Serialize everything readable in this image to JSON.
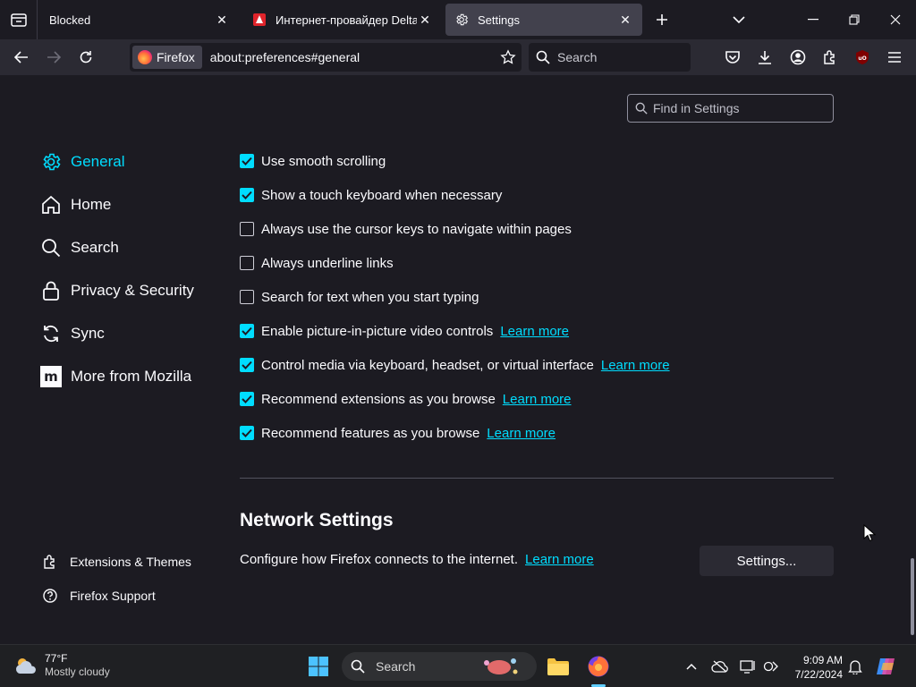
{
  "tabs": [
    {
      "label": "Blocked",
      "icon": "none"
    },
    {
      "label": "Интернет-провайдер Delta – Р",
      "icon": "delta-favicon"
    },
    {
      "label": "Settings",
      "icon": "gear-icon"
    }
  ],
  "navbar": {
    "identity_label": "Firefox",
    "url": "about:preferences#general",
    "search_placeholder": "Search"
  },
  "find_placeholder": "Find in Settings",
  "sidebar": {
    "items": [
      {
        "label": "General",
        "icon": "gear-icon",
        "selected": true
      },
      {
        "label": "Home",
        "icon": "home-icon"
      },
      {
        "label": "Search",
        "icon": "search-icon"
      },
      {
        "label": "Privacy & Security",
        "icon": "lock-icon"
      },
      {
        "label": "Sync",
        "icon": "sync-icon"
      },
      {
        "label": "More from Mozilla",
        "icon": "mozilla-icon"
      }
    ],
    "footer": [
      {
        "label": "Extensions & Themes",
        "icon": "puzzle-icon"
      },
      {
        "label": "Firefox Support",
        "icon": "help-icon"
      }
    ]
  },
  "options": [
    {
      "label": "Use smooth scrolling",
      "checked": true
    },
    {
      "label": "Show a touch keyboard when necessary",
      "checked": true
    },
    {
      "label": "Always use the cursor keys to navigate within pages",
      "checked": false
    },
    {
      "label": "Always underline links",
      "checked": false
    },
    {
      "label": "Search for text when you start typing",
      "checked": false
    },
    {
      "label": "Enable picture-in-picture video controls",
      "checked": true,
      "link": "Learn more"
    },
    {
      "label": "Control media via keyboard, headset, or virtual interface",
      "checked": true,
      "link": "Learn more"
    },
    {
      "label": "Recommend extensions as you browse",
      "checked": true,
      "link": "Learn more"
    },
    {
      "label": "Recommend features as you browse",
      "checked": true,
      "link": "Learn more"
    }
  ],
  "network": {
    "title": "Network Settings",
    "description": "Configure how Firefox connects to the internet.",
    "link": "Learn more",
    "button": "Settings..."
  },
  "taskbar": {
    "weather_temp": "77°F",
    "weather_desc": "Mostly cloudy",
    "search_label": "Search",
    "time": "9:09 AM",
    "date": "7/22/2024"
  },
  "colors": {
    "accent": "#00ddff",
    "background": "#1c1b22",
    "toolbar": "#2b2a33"
  }
}
